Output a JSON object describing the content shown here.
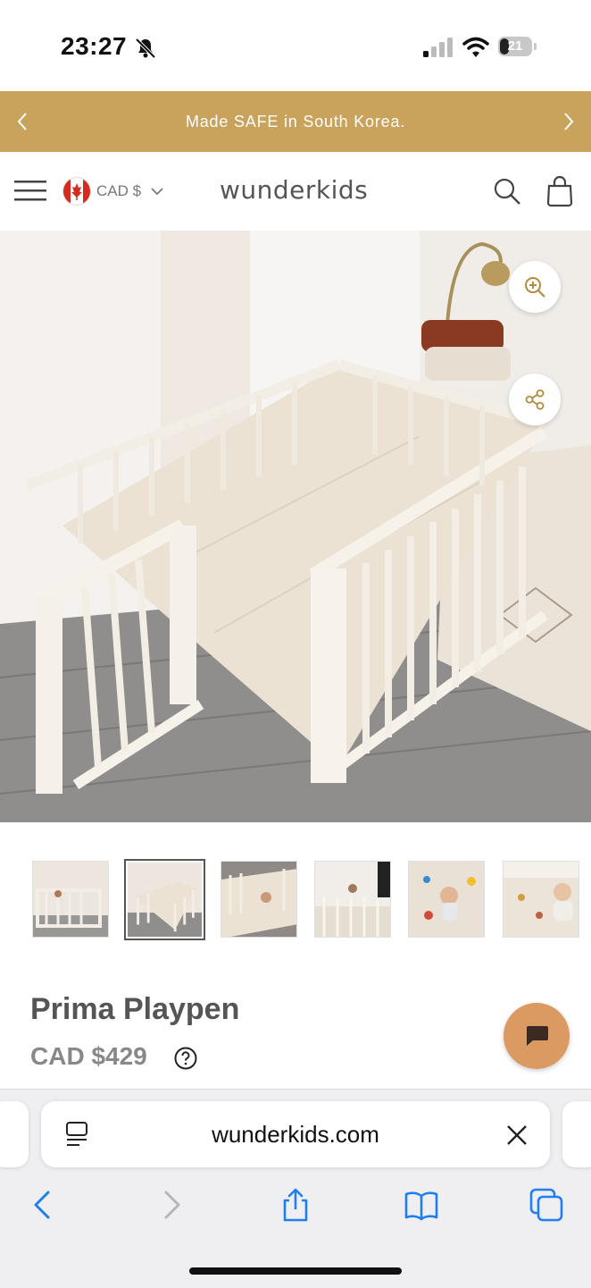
{
  "status_bar": {
    "time": "23:27",
    "battery": "21"
  },
  "announcement": {
    "text": "Made SAFE in South Korea."
  },
  "header": {
    "currency": "CAD $",
    "logo": "wunderkids"
  },
  "product": {
    "title": "Prima Playpen",
    "price": "CAD $429"
  },
  "thumbnails": {
    "count": 6,
    "active_index": 1
  },
  "browser": {
    "url": "wunderkids.com"
  },
  "icons": {
    "status": [
      "bell-muted-icon",
      "signal-icon",
      "wifi-icon",
      "battery-icon"
    ],
    "header": [
      "menu-icon",
      "canada-flag-icon",
      "chevron-down-icon",
      "search-icon",
      "bag-icon"
    ],
    "hero": [
      "zoom-in-icon",
      "share-icon"
    ],
    "toolbar": [
      "back-icon",
      "forward-icon",
      "share-icon",
      "bookmarks-icon",
      "tabs-icon"
    ]
  },
  "colors": {
    "announcement_bg": "#c9a35c",
    "chat_bg": "#dc9a63",
    "safari_blue": "#1f7ef1"
  }
}
